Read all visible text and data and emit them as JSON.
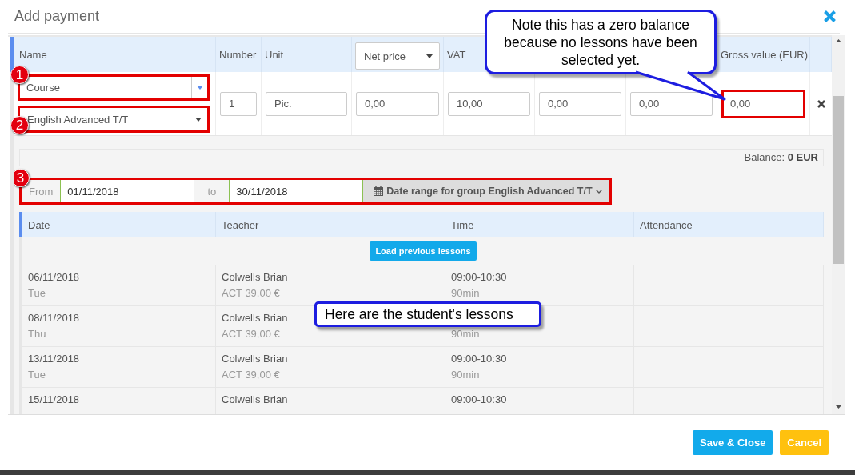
{
  "dialog": {
    "title": "Add payment"
  },
  "items_table": {
    "columns": [
      {
        "kind": "label",
        "label": "Name"
      },
      {
        "kind": "label",
        "label": "Number"
      },
      {
        "kind": "label",
        "label": "Unit"
      },
      {
        "kind": "select",
        "label": "Net price"
      },
      {
        "kind": "label",
        "label": "VAT"
      },
      {
        "kind": "label"
      },
      {
        "kind": "label"
      },
      {
        "kind": "label",
        "label": "Gross value (EUR)"
      }
    ],
    "row": {
      "type_select": {
        "value": "Course",
        "highlighted": true,
        "marker": "1"
      },
      "item_select": {
        "value": "English Advanced T/T",
        "highlighted": true,
        "marker": "2"
      },
      "fields": [
        {
          "value": "1",
          "highlighted": false
        },
        {
          "value": "Pic.",
          "highlighted": false
        },
        {
          "value": "0,00",
          "highlighted": false
        },
        {
          "value": "10,00",
          "highlighted": false
        },
        {
          "value": "0,00",
          "highlighted": false
        },
        {
          "value": "0,00",
          "highlighted": false
        },
        {
          "value": "0,00",
          "highlighted": true
        }
      ]
    }
  },
  "balance": "Balance: **0 EUR**",
  "date_range": {
    "highlighted": true,
    "marker": "3",
    "from_label": "From",
    "from": "01/11/2018",
    "to_label": "to",
    "to": "30/11/2018",
    "button": "Date range for group English Advanced T/T"
  },
  "lessons_table": {
    "columns": [
      "Date",
      "Teacher",
      "Time",
      "Attendance"
    ],
    "load_button": "Load previous lessons",
    "rows": [
      {
        "date": "06/11/2018",
        "day": "Tue",
        "teacher": "Colwells Brian",
        "rate": "ACT 39,00 €",
        "time": "09:00-10:30",
        "duration": "90min"
      },
      {
        "date": "08/11/2018",
        "day": "Thu",
        "teacher": "Colwells Brian",
        "rate": "ACT 39,00 €",
        "duration": "90min"
      },
      {
        "date": "13/11/2018",
        "day": "Tue",
        "teacher": "Colwells Brian",
        "rate": "ACT 39,00 €",
        "time": "09:00-10:30",
        "duration": "90min"
      },
      {
        "date": "15/11/2018",
        "teacher": "Colwells Brian",
        "time": "09:00-10:30"
      }
    ]
  },
  "footer_buttons": [
    {
      "label": "Save & Close",
      "kind": "save"
    },
    {
      "label": "Cancel",
      "kind": "cancel"
    }
  ],
  "callouts": [
    {
      "kind": "pointer",
      "text": "Note this has a zero balance because no lessons have been selected yet."
    },
    {
      "kind": "plain",
      "text": "Here are the student's lessons"
    }
  ]
}
